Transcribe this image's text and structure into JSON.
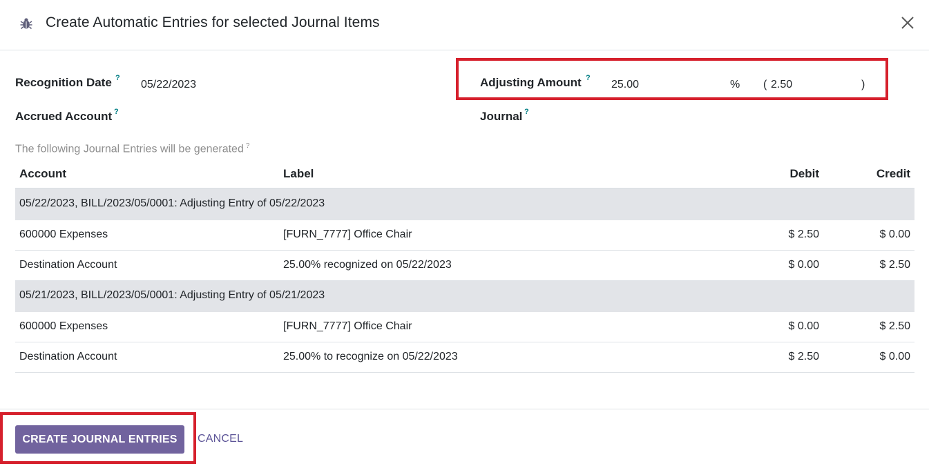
{
  "dialog": {
    "title": "Create Automatic Entries for selected Journal Items",
    "icon": "bug-icon"
  },
  "form": {
    "recognition_date_label": "Recognition Date",
    "recognition_date_value": "05/22/2023",
    "accrued_account_label": "Accrued Account",
    "accrued_account_value": "",
    "adjusting_amount_label": "Adjusting Amount",
    "adjusting_amount_value": "25.00",
    "percent_symbol": "%",
    "amount_open": "(",
    "amount_value": "2.50",
    "amount_close": ")",
    "journal_label": "Journal",
    "journal_value": "",
    "help_marker": "?"
  },
  "preview": {
    "note": "The following Journal Entries will be generated",
    "columns": [
      "Account",
      "Label",
      "Debit",
      "Credit"
    ],
    "groups": [
      {
        "title": "05/22/2023, BILL/2023/05/0001: Adjusting Entry of 05/22/2023",
        "lines": [
          {
            "account": "600000 Expenses",
            "label": "[FURN_7777] Office Chair",
            "debit": "$ 2.50",
            "credit": "$ 0.00"
          },
          {
            "account": "Destination Account",
            "label": "25.00% recognized on 05/22/2023",
            "debit": "$ 0.00",
            "credit": "$ 2.50"
          }
        ]
      },
      {
        "title": "05/21/2023, BILL/2023/05/0001: Adjusting Entry of 05/21/2023",
        "lines": [
          {
            "account": "600000 Expenses",
            "label": "[FURN_7777] Office Chair",
            "debit": "$ 0.00",
            "credit": "$ 2.50"
          },
          {
            "account": "Destination Account",
            "label": "25.00% to recognize on 05/22/2023",
            "debit": "$ 2.50",
            "credit": "$ 0.00"
          }
        ]
      }
    ]
  },
  "footer": {
    "create_label": "CREATE JOURNAL ENTRIES",
    "cancel_label": "CANCEL"
  },
  "colors": {
    "primary": "#71639e",
    "highlight": "#d6202c",
    "help": "#017e84",
    "group_row": "#e2e4e8"
  }
}
